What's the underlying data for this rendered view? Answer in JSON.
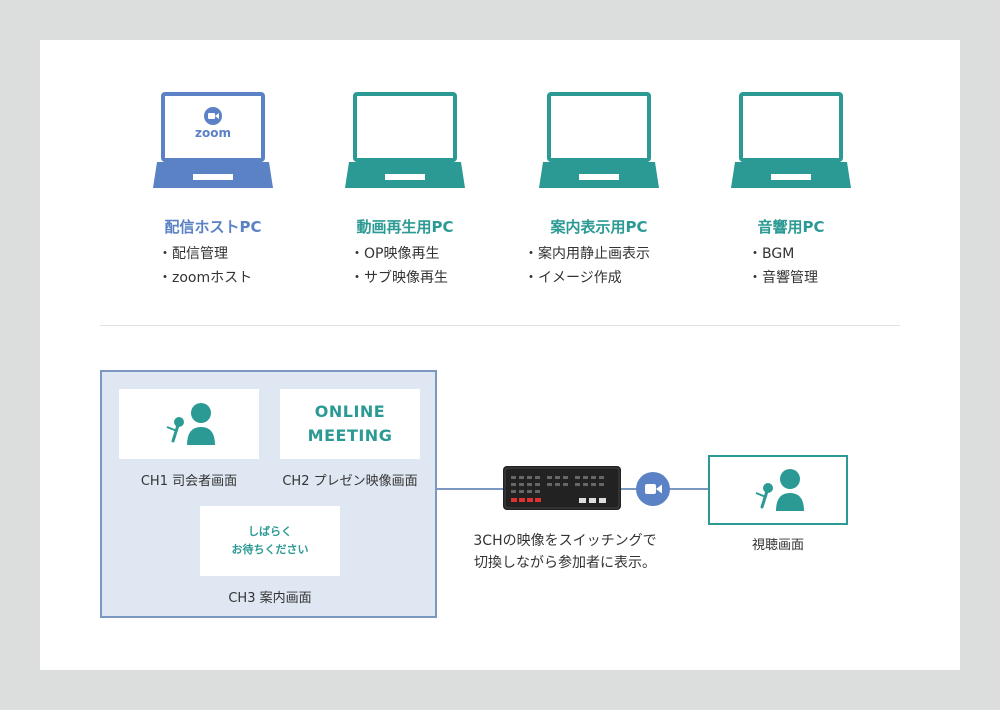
{
  "colors": {
    "blue": "#5a82c4",
    "teal": "#2c9a94",
    "group_bg": "#dfe8f2",
    "group_border": "#7b97c2"
  },
  "pcs": [
    {
      "title": "配信ホストPC",
      "color": "#5a82c4",
      "items": [
        "・配信管理",
        "・zoomホスト"
      ],
      "screen_logo": "zoom"
    },
    {
      "title": "動画再生用PC",
      "color": "#2c9a94",
      "items": [
        "・OP映像再生",
        "・サブ映像再生"
      ]
    },
    {
      "title": "案内表示用PC",
      "color": "#2c9a94",
      "items": [
        "・案内用静止画表示",
        "・イメージ作成"
      ]
    },
    {
      "title": "音響用PC",
      "color": "#2c9a94",
      "items": [
        "・BGM",
        "・音響管理"
      ]
    }
  ],
  "channels": {
    "ch1_caption": "CH1 司会者画面",
    "ch2_caption": "CH2 プレゼン映像画面",
    "ch2_line1": "ONLINE",
    "ch2_line2": "MEETING",
    "ch3_caption": "CH3 案内画面",
    "ch3_line1": "しばらく",
    "ch3_line2": "お待ちください"
  },
  "switch_caption_line1": "3CHの映像をスイッチングで",
  "switch_caption_line2": "切換しながら参加者に表示。",
  "viewer_caption": "視聴画面"
}
